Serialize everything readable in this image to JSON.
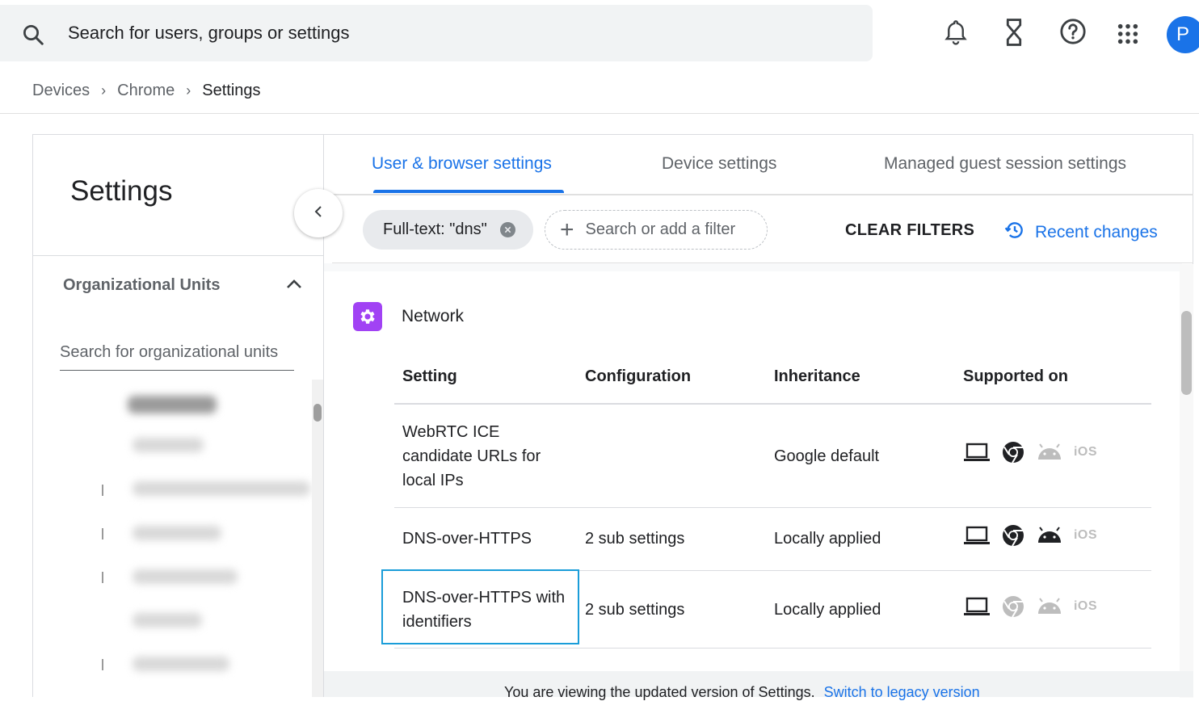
{
  "topbar": {
    "search_placeholder": "Search for users, groups or settings",
    "avatar_letter": "P",
    "icons": [
      "search-icon",
      "bell-icon",
      "hourglass-icon",
      "help-icon",
      "apps-grid-icon"
    ]
  },
  "breadcrumb": {
    "items": [
      "Devices",
      "Chrome",
      "Settings"
    ]
  },
  "sidebar": {
    "title": "Settings",
    "org_units_label": "Organizational Units",
    "org_search_placeholder": "Search for organizational units"
  },
  "tabs": [
    {
      "label": "User & browser settings",
      "active": true
    },
    {
      "label": "Device settings",
      "active": false
    },
    {
      "label": "Managed guest session settings",
      "active": false
    }
  ],
  "filters": {
    "chip_label": "Full-text: \"dns\"",
    "add_filter_placeholder": "Search or add a filter",
    "clear_label": "CLEAR FILTERS",
    "recent_changes_label": "Recent changes"
  },
  "section": {
    "title": "Network",
    "columns": [
      "Setting",
      "Configuration",
      "Inheritance",
      "Supported on"
    ],
    "rows": [
      {
        "setting_lines": [
          "WebRTC ICE",
          "candidate URLs for",
          "local IPs"
        ],
        "configuration": "",
        "inheritance": "Google default",
        "platforms": {
          "windows_mac_linux": true,
          "chromeos": true,
          "android": false,
          "ios": false
        }
      },
      {
        "setting_lines": [
          "DNS-over-HTTPS"
        ],
        "configuration": "2 sub settings",
        "inheritance": "Locally applied",
        "platforms": {
          "windows_mac_linux": true,
          "chromeos": true,
          "android": true,
          "ios": false
        }
      },
      {
        "setting_lines": [
          "DNS-over-HTTPS with",
          "identifiers"
        ],
        "configuration": "2 sub settings",
        "inheritance": "Locally applied",
        "platforms": {
          "windows_mac_linux": true,
          "chromeos": false,
          "android": false,
          "ios": false
        }
      }
    ],
    "ios_label": "iOS"
  },
  "banner": {
    "text": "You are viewing the updated version of Settings.",
    "link": "Switch to legacy version"
  },
  "colors": {
    "accent": "#1a73e8",
    "network_icon": "#a142f4",
    "highlight": "#1a9dd9"
  }
}
